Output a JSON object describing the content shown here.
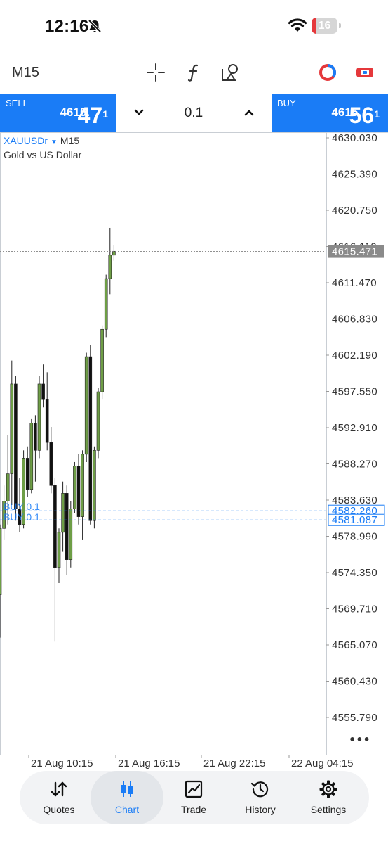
{
  "status_bar": {
    "time": "12:16",
    "battery": "16",
    "battery_level": 0.16
  },
  "toolbar": {
    "timeframe": "M15",
    "icons": [
      "crosshair-icon",
      "indicators-icon",
      "objects-icon",
      "timeframe-circle-icon",
      "chart-type-icon"
    ]
  },
  "trade": {
    "sell_label": "SELL",
    "sell_price_small": "4615.",
    "sell_price_big": "47",
    "sell_price_super": "1",
    "buy_label": "BUY",
    "buy_price_small": "4615.",
    "buy_price_big": "56",
    "buy_price_super": "1",
    "lot": "0.1"
  },
  "chart": {
    "symbol": "XAUUSDr",
    "timeframe": "M15",
    "description": "Gold vs US Dollar",
    "price_labels": [
      "4630.030",
      "4625.390",
      "4620.750",
      "4616.110",
      "4611.470",
      "4606.830",
      "4602.190",
      "4597.550",
      "4592.910",
      "4588.270",
      "4583.630",
      "4578.990",
      "4574.350",
      "4569.710",
      "4565.070",
      "4560.430",
      "4555.790"
    ],
    "current_price": "4615.471",
    "time_labels": [
      "21 Aug 10:15",
      "21 Aug 16:15",
      "21 Aug 22:15",
      "22 Aug 04:15"
    ],
    "positions": [
      {
        "label": "BUY 0.1",
        "price": "4582.260"
      },
      {
        "label": "BUY 0.1",
        "price": "4581.087"
      }
    ],
    "more": "•••",
    "colors": {
      "bull": "#6e9e46",
      "bear": "#111111",
      "line": "#1a7cf6",
      "current": "#808080"
    },
    "candles": [
      {
        "o": 4571.5,
        "h": 4580.5,
        "l": 4566.0,
        "c": 4580.0
      },
      {
        "o": 4580.0,
        "h": 4585.5,
        "l": 4578.5,
        "c": 4583.5
      },
      {
        "o": 4583.5,
        "h": 4592.0,
        "l": 4580.5,
        "c": 4587.0
      },
      {
        "o": 4587.0,
        "h": 4601.5,
        "l": 4583.0,
        "c": 4598.5
      },
      {
        "o": 4598.5,
        "h": 4599.5,
        "l": 4581.0,
        "c": 4582.5
      },
      {
        "o": 4582.5,
        "h": 4586.5,
        "l": 4579.5,
        "c": 4580.5
      },
      {
        "o": 4580.5,
        "h": 4590.0,
        "l": 4580.0,
        "c": 4589.0
      },
      {
        "o": 4589.0,
        "h": 4590.5,
        "l": 4584.0,
        "c": 4585.0
      },
      {
        "o": 4585.0,
        "h": 4594.0,
        "l": 4584.5,
        "c": 4593.5
      },
      {
        "o": 4593.5,
        "h": 4594.5,
        "l": 4586.0,
        "c": 4590.0
      },
      {
        "o": 4590.0,
        "h": 4599.5,
        "l": 4589.0,
        "c": 4598.5
      },
      {
        "o": 4598.5,
        "h": 4601.0,
        "l": 4595.5,
        "c": 4596.5
      },
      {
        "o": 4596.5,
        "h": 4600.0,
        "l": 4590.0,
        "c": 4591.0
      },
      {
        "o": 4591.0,
        "h": 4593.0,
        "l": 4584.5,
        "c": 4585.5
      },
      {
        "o": 4585.5,
        "h": 4586.5,
        "l": 4565.5,
        "c": 4575.0
      },
      {
        "o": 4575.0,
        "h": 4580.0,
        "l": 4573.0,
        "c": 4579.5
      },
      {
        "o": 4579.5,
        "h": 4586.0,
        "l": 4577.0,
        "c": 4584.5
      },
      {
        "o": 4584.5,
        "h": 4585.5,
        "l": 4574.0,
        "c": 4576.0
      },
      {
        "o": 4576.0,
        "h": 4583.5,
        "l": 4575.0,
        "c": 4582.5
      },
      {
        "o": 4582.5,
        "h": 4588.5,
        "l": 4582.0,
        "c": 4588.0
      },
      {
        "o": 4588.0,
        "h": 4589.5,
        "l": 4580.5,
        "c": 4581.5
      },
      {
        "o": 4581.5,
        "h": 4590.0,
        "l": 4578.5,
        "c": 4589.5
      },
      {
        "o": 4589.5,
        "h": 4602.5,
        "l": 4588.5,
        "c": 4602.0
      },
      {
        "o": 4602.0,
        "h": 4603.5,
        "l": 4580.5,
        "c": 4581.0
      },
      {
        "o": 4581.0,
        "h": 4590.5,
        "l": 4580.0,
        "c": 4590.0
      },
      {
        "o": 4590.0,
        "h": 4598.0,
        "l": 4589.0,
        "c": 4597.5
      },
      {
        "o": 4597.5,
        "h": 4606.0,
        "l": 4596.5,
        "c": 4605.5
      },
      {
        "o": 4605.5,
        "h": 4612.5,
        "l": 4604.5,
        "c": 4612.0
      },
      {
        "o": 4612.0,
        "h": 4618.5,
        "l": 4610.0,
        "c": 4615.0
      },
      {
        "o": 4615.0,
        "h": 4616.3,
        "l": 4614.3,
        "c": 4615.5
      }
    ]
  },
  "nav": [
    {
      "label": "Quotes",
      "icon": "quotes-arrows-icon"
    },
    {
      "label": "Chart",
      "icon": "chart-candles-icon",
      "active": true
    },
    {
      "label": "Trade",
      "icon": "trade-chart-icon"
    },
    {
      "label": "History",
      "icon": "history-clock-icon"
    },
    {
      "label": "Settings",
      "icon": "settings-gear-icon"
    }
  ]
}
